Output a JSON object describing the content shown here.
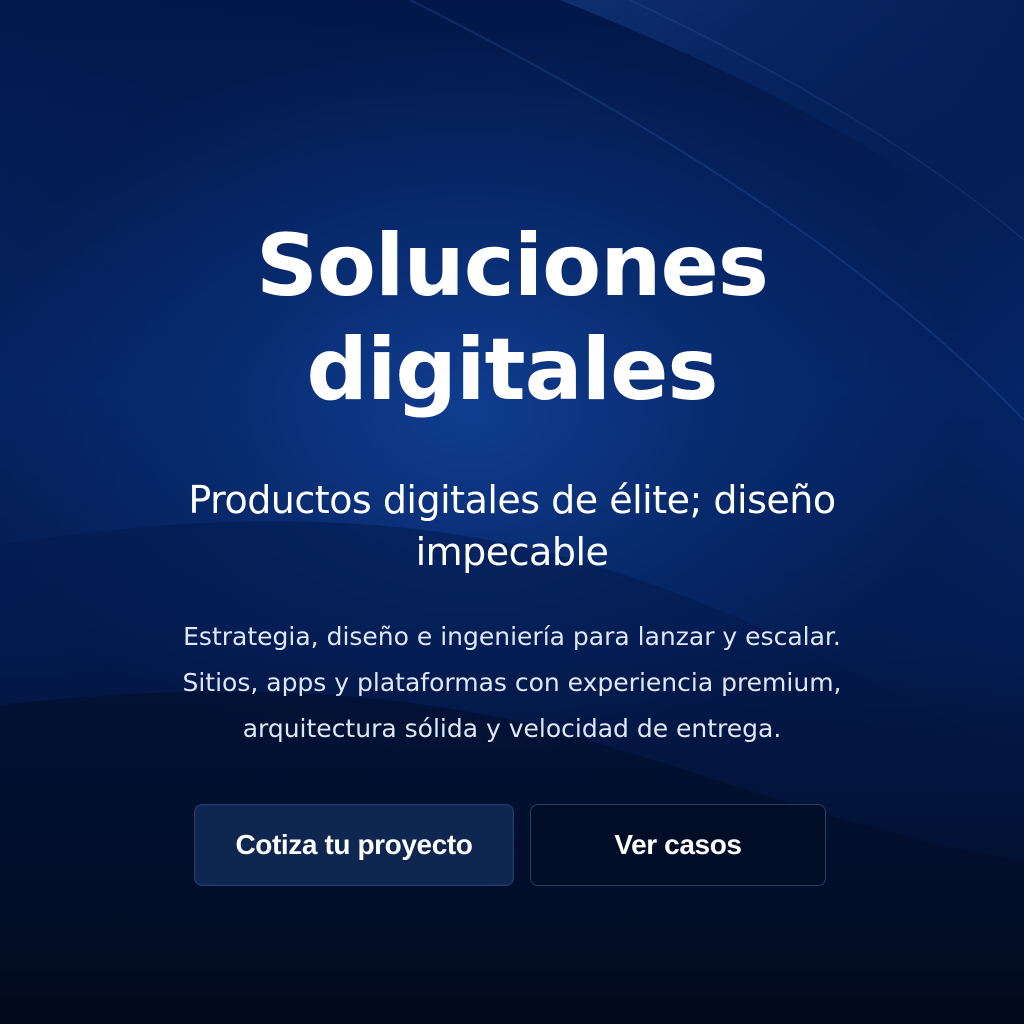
{
  "hero": {
    "title_line_1": "Soluciones",
    "title_line_2": "digitales",
    "subtitle_line_1": "Productos digitales de élite; diseño",
    "subtitle_line_2": "impecable",
    "description_lines": [
      "Estrategia, diseño e ingeniería para lanzar y escalar.",
      "Sitios, apps y plataformas con experiencia premium,",
      "arquitectura sólida y velocidad de entrega."
    ],
    "primary_cta": "Cotiza tu proyecto",
    "secondary_cta": "Ver casos"
  },
  "colors": {
    "background_dark": "#020d2b",
    "background_blue": "#062a72",
    "primary_button": "#0f2650",
    "text": "#ffffff"
  }
}
